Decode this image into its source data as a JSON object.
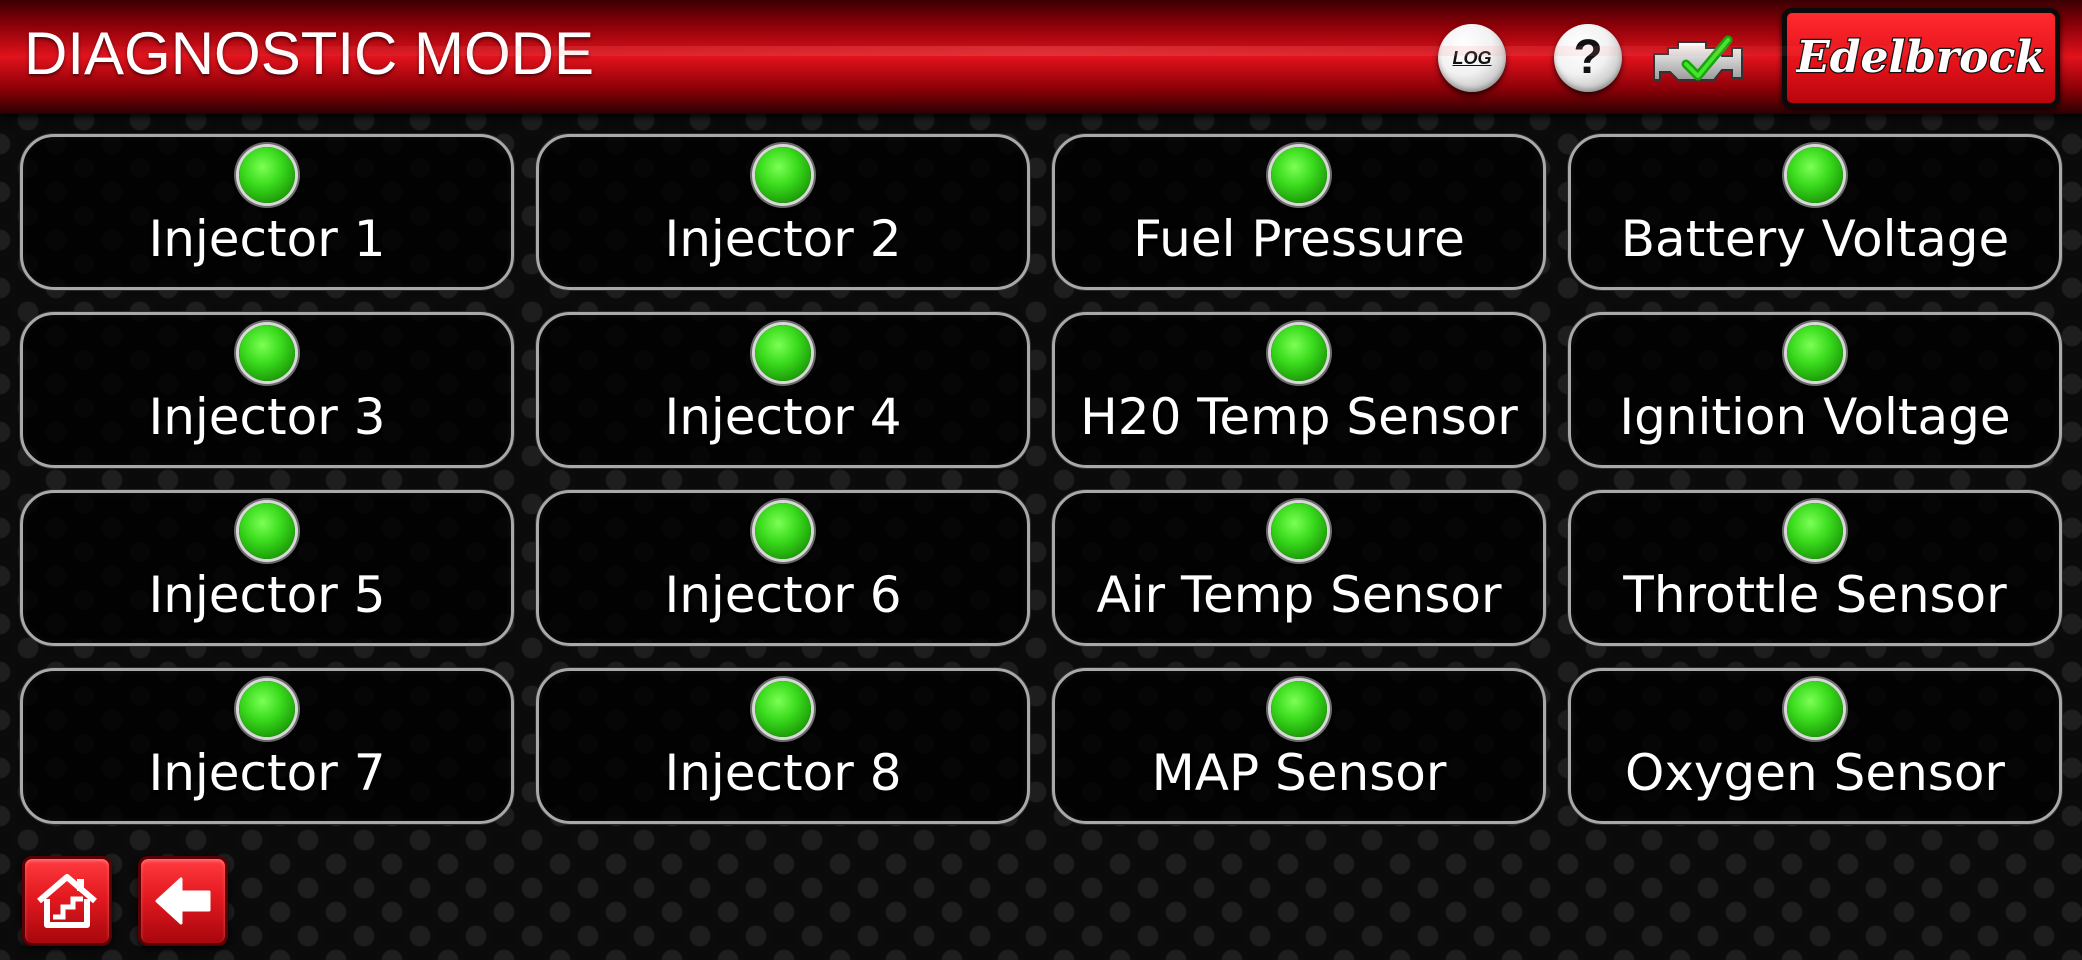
{
  "header": {
    "title": "DIAGNOSTIC MODE",
    "log_label": "LOG",
    "help_label": "?",
    "brand_logo_text": "Edelbrock",
    "engine_status_icon": "check-engine-ok-icon"
  },
  "colors": {
    "header_red": "#e1121c",
    "status_green": "#3bdc1e",
    "tile_border": "#a9a9a9"
  },
  "tiles": [
    {
      "label": "Injector 1",
      "status": "ok"
    },
    {
      "label": "Injector 2",
      "status": "ok"
    },
    {
      "label": "Fuel Pressure",
      "status": "ok"
    },
    {
      "label": "Battery Voltage",
      "status": "ok"
    },
    {
      "label": "Injector 3",
      "status": "ok"
    },
    {
      "label": "Injector 4",
      "status": "ok"
    },
    {
      "label": "H20 Temp Sensor",
      "status": "ok"
    },
    {
      "label": "Ignition Voltage",
      "status": "ok"
    },
    {
      "label": "Injector 5",
      "status": "ok"
    },
    {
      "label": "Injector 6",
      "status": "ok"
    },
    {
      "label": "Air Temp Sensor",
      "status": "ok"
    },
    {
      "label": "Throttle Sensor",
      "status": "ok"
    },
    {
      "label": "Injector 7",
      "status": "ok"
    },
    {
      "label": "Injector 8",
      "status": "ok"
    },
    {
      "label": "MAP Sensor",
      "status": "ok"
    },
    {
      "label": "Oxygen Sensor",
      "status": "ok"
    }
  ],
  "footer": {
    "home_icon": "home-icon",
    "back_icon": "back-arrow-icon"
  }
}
